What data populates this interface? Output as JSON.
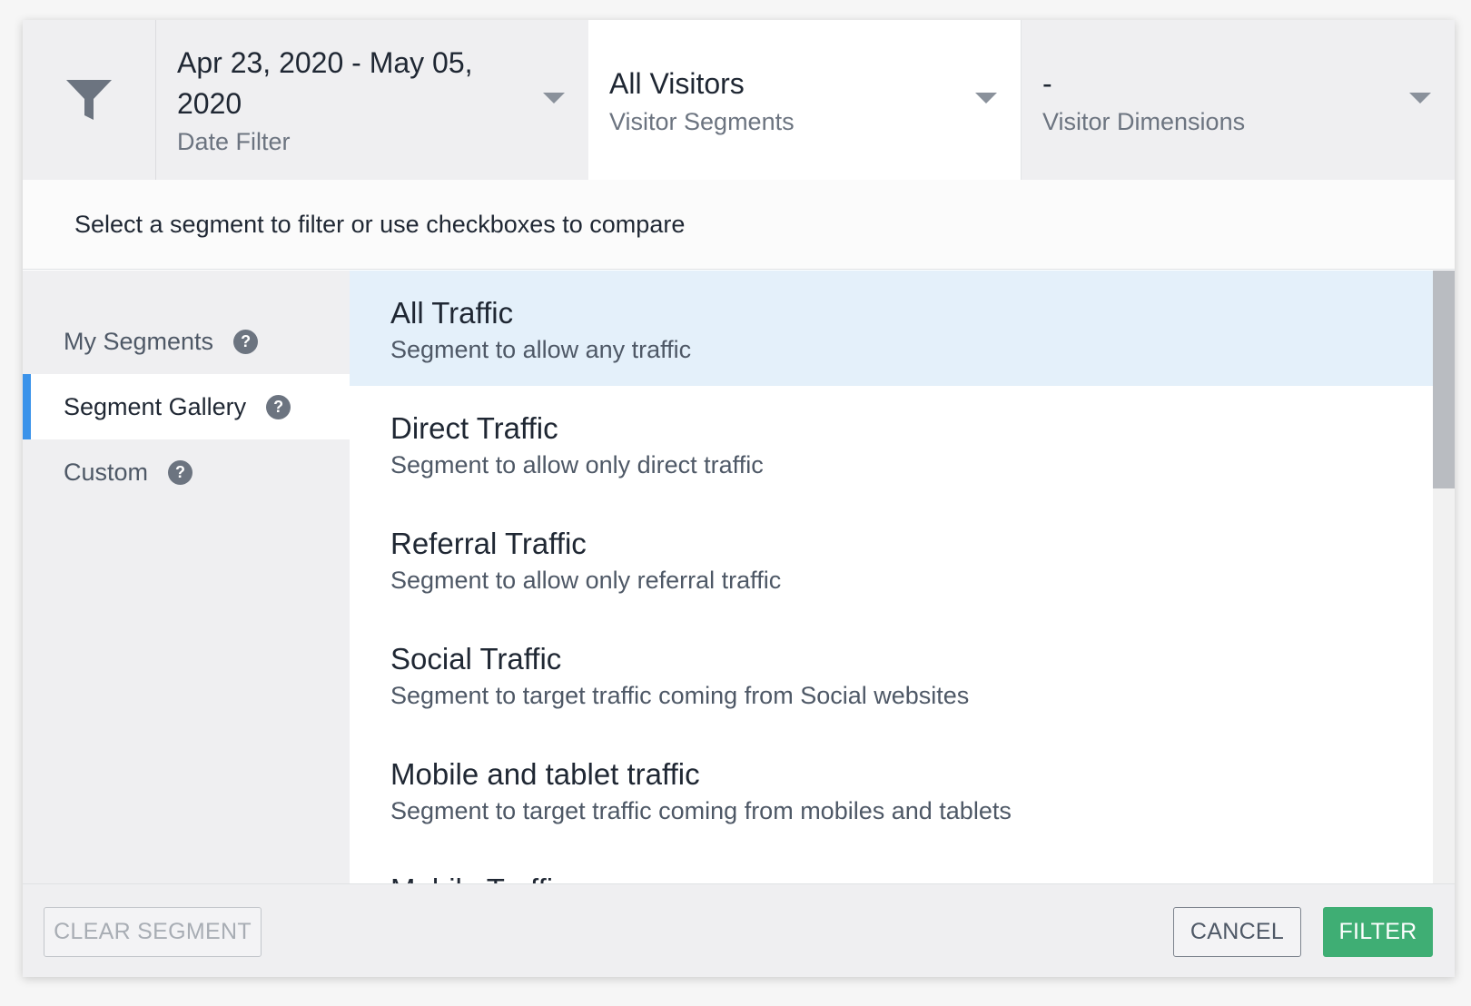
{
  "filters": {
    "date": {
      "value": "Apr 23, 2020 - May 05, 2020",
      "label": "Date Filter"
    },
    "segments": {
      "value": "All Visitors",
      "label": "Visitor Segments"
    },
    "dimensions": {
      "value": "-",
      "label": "Visitor Dimensions"
    }
  },
  "icons": {
    "filter": "funnel-icon",
    "caret": "caret-down-icon",
    "help": "question-circle-icon"
  },
  "hint": "Select a segment to filter or use checkboxes to compare",
  "sidebar": {
    "items": [
      {
        "label": "My Segments",
        "help": "?"
      },
      {
        "label": "Segment Gallery",
        "help": "?"
      },
      {
        "label": "Custom",
        "help": "?"
      }
    ],
    "active_item": "Segment Gallery"
  },
  "segments": [
    {
      "title": "All Traffic",
      "description": "Segment to allow any traffic"
    },
    {
      "title": "Direct Traffic",
      "description": "Segment to allow only direct traffic"
    },
    {
      "title": "Referral Traffic",
      "description": "Segment to allow only referral traffic"
    },
    {
      "title": "Social Traffic",
      "description": "Segment to target traffic coming from Social websites"
    },
    {
      "title": "Mobile and tablet traffic",
      "description": "Segment to target traffic coming from mobiles and tablets"
    },
    {
      "title": "Mobile Traffic",
      "description": ""
    }
  ],
  "selected_segment": "All Traffic",
  "footer": {
    "clear_label": "CLEAR SEGMENT",
    "cancel_label": "CANCEL",
    "filter_label": "FILTER"
  },
  "colors": {
    "accent_blue": "#3b93ea",
    "filter_green": "#3fae74",
    "selected_bg": "#e4f0fa"
  }
}
